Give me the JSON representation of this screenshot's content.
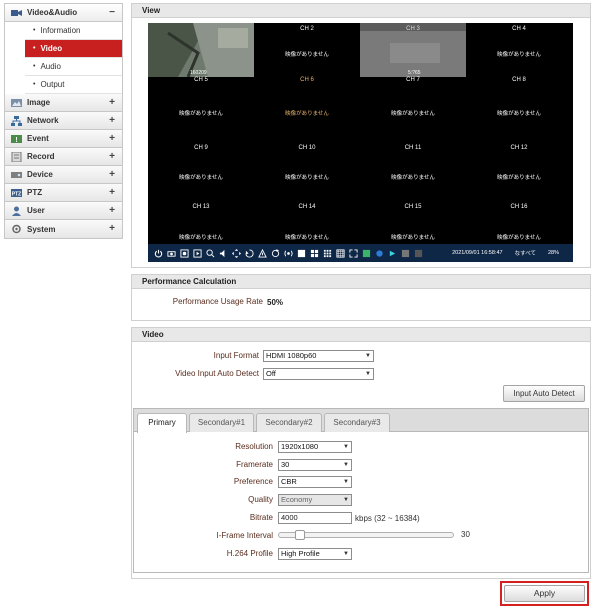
{
  "sidebar": {
    "video_audio": {
      "label": "Video&Audio",
      "sign": "−"
    },
    "subitems": [
      {
        "label": "Information"
      },
      {
        "label": "Video"
      },
      {
        "label": "Audio"
      },
      {
        "label": "Output"
      }
    ],
    "items": [
      {
        "label": "Image",
        "sign": "+"
      },
      {
        "label": "Network",
        "sign": "+"
      },
      {
        "label": "Event",
        "sign": "+"
      },
      {
        "label": "Record",
        "sign": "+"
      },
      {
        "label": "Device",
        "sign": "+"
      },
      {
        "label": "PTZ",
        "sign": "+"
      },
      {
        "label": "User",
        "sign": "+"
      },
      {
        "label": "System",
        "sign": "+"
      }
    ]
  },
  "view": {
    "title": "View",
    "no_video_text": "映像がありません",
    "channels": [
      "",
      "CH 2",
      "CH 3",
      "CH 4",
      "CH 5",
      "CH 6",
      "CH 7",
      "CH 8",
      "CH 9",
      "CH 10",
      "CH 11",
      "CH 12",
      "CH 13",
      "CH 14",
      "CH 15",
      "CH 16"
    ],
    "ch1_timestamp": "160209",
    "ch3_timestamp": "5:?65",
    "toolbar_datetime": "2021/09/01 16:58:47",
    "toolbar_select": "なすべて",
    "toolbar_zoom": "28%"
  },
  "performance": {
    "title": "Performance Calculation",
    "label": "Performance Usage Rate",
    "value": "50%"
  },
  "video": {
    "title": "Video",
    "input_format_label": "Input Format",
    "input_format_value": "HDMI 1080p60",
    "auto_detect_label": "Video Input Auto Detect",
    "auto_detect_value": "Off",
    "auto_detect_button": "Input Auto Detect"
  },
  "tabs": [
    {
      "label": "Primary"
    },
    {
      "label": "Secondary#1"
    },
    {
      "label": "Secondary#2"
    },
    {
      "label": "Secondary#3"
    }
  ],
  "stream": {
    "resolution_label": "Resolution",
    "resolution_value": "1920x1080",
    "framerate_label": "Framerate",
    "framerate_value": "30",
    "preference_label": "Preference",
    "preference_value": "CBR",
    "quality_label": "Quality",
    "quality_value": "Economy",
    "bitrate_label": "Bitrate",
    "bitrate_value": "4000",
    "bitrate_range": "kbps (32 ~ 16384)",
    "iframe_label": "I-Frame Interval",
    "iframe_value": "30",
    "h264_label": "H.264 Profile",
    "h264_value": "High Profile"
  },
  "apply_label": "Apply",
  "colors": {
    "accent": "#c8201f",
    "toolbar": "#0e2746",
    "label": "#5a2d1e"
  }
}
